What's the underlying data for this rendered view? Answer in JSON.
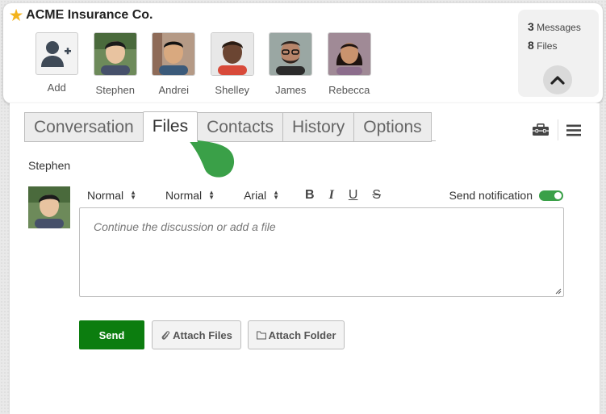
{
  "header": {
    "company": "ACME Insurance Co.",
    "add_label": "Add",
    "people": [
      {
        "name": "Stephen",
        "skin": "#e8c3a0",
        "hair": "#1b1b1b",
        "shirt": "#46506a"
      },
      {
        "name": "Andrei",
        "skin": "#d9a97f",
        "hair": "#111111",
        "shirt": "#3b5a7a"
      },
      {
        "name": "Shelley",
        "skin": "#6b4532",
        "hair": "#2a1c14",
        "shirt": "#d84a3a"
      },
      {
        "name": "James",
        "skin": "#b7856a",
        "hair": "#2d2420",
        "shirt": "#2b2b2b"
      },
      {
        "name": "Rebecca",
        "skin": "#c9936e",
        "hair": "#1e1411",
        "shirt": "#8c6d8c"
      }
    ]
  },
  "stats": {
    "messages_count": "3",
    "messages_label": "Messages",
    "files_count": "8",
    "files_label": "Files"
  },
  "tabs": [
    "Conversation",
    "Files",
    "Contacts",
    "History",
    "Options"
  ],
  "active_tab": "Files",
  "composer": {
    "author": "Stephen",
    "style_select": "Normal",
    "size_select": "Normal",
    "font_select": "Arial",
    "notify_label": "Send notification",
    "notify_on": true,
    "placeholder": "Continue the discussion or add a file",
    "send_label": "Send",
    "attach_files_label": "Attach Files",
    "attach_folder_label": "Attach Folder"
  },
  "colors": {
    "accent_green": "#3aa048",
    "send_green": "#0c7d0f",
    "star": "#f3b31c"
  }
}
